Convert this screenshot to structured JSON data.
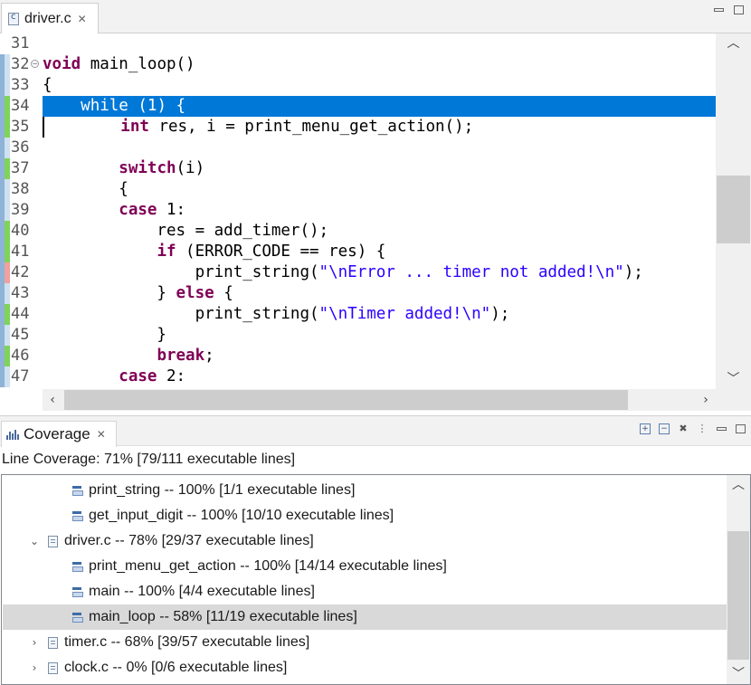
{
  "editor": {
    "tab": {
      "label": "driver.c",
      "icon": "c-file-icon"
    },
    "lines": [
      {
        "num": "31",
        "cov": "",
        "fold": false,
        "hl": false,
        "tokens": []
      },
      {
        "num": "32",
        "cov": "",
        "fold": true,
        "hl": false,
        "tokens": [
          {
            "t": "void",
            "c": "kw"
          },
          {
            "t": " main_loop()",
            "c": ""
          }
        ]
      },
      {
        "num": "33",
        "cov": "",
        "fold": false,
        "hl": false,
        "tokens": [
          {
            "t": "{",
            "c": ""
          }
        ]
      },
      {
        "num": "34",
        "cov": "green",
        "fold": false,
        "hl": true,
        "tokens": [
          {
            "t": "    ",
            "c": ""
          },
          {
            "t": "while",
            "c": "kw"
          },
          {
            "t": " (1) {",
            "c": ""
          }
        ]
      },
      {
        "num": "35",
        "cov": "green",
        "fold": false,
        "hl": false,
        "caret": true,
        "tokens": [
          {
            "t": "        ",
            "c": ""
          },
          {
            "t": "int",
            "c": "kw"
          },
          {
            "t": " res, i = print_menu_get_action();",
            "c": ""
          }
        ]
      },
      {
        "num": "36",
        "cov": "",
        "fold": false,
        "hl": false,
        "tokens": []
      },
      {
        "num": "37",
        "cov": "green",
        "fold": false,
        "hl": false,
        "tokens": [
          {
            "t": "        ",
            "c": ""
          },
          {
            "t": "switch",
            "c": "kw"
          },
          {
            "t": "(i)",
            "c": ""
          }
        ]
      },
      {
        "num": "38",
        "cov": "",
        "fold": false,
        "hl": false,
        "tokens": [
          {
            "t": "        {",
            "c": ""
          }
        ]
      },
      {
        "num": "39",
        "cov": "",
        "fold": false,
        "hl": false,
        "tokens": [
          {
            "t": "        ",
            "c": ""
          },
          {
            "t": "case",
            "c": "kw"
          },
          {
            "t": " 1:",
            "c": ""
          }
        ]
      },
      {
        "num": "40",
        "cov": "green",
        "fold": false,
        "hl": false,
        "tokens": [
          {
            "t": "            res = add_timer();",
            "c": ""
          }
        ]
      },
      {
        "num": "41",
        "cov": "green",
        "fold": false,
        "hl": false,
        "tokens": [
          {
            "t": "            ",
            "c": ""
          },
          {
            "t": "if",
            "c": "kw"
          },
          {
            "t": " (ERROR_CODE == res) {",
            "c": ""
          }
        ]
      },
      {
        "num": "42",
        "cov": "red",
        "fold": false,
        "hl": false,
        "tokens": [
          {
            "t": "                print_string(",
            "c": ""
          },
          {
            "t": "\"\\nError ... timer not added!\\n\"",
            "c": "str"
          },
          {
            "t": ");",
            "c": ""
          }
        ]
      },
      {
        "num": "43",
        "cov": "",
        "fold": false,
        "hl": false,
        "tokens": [
          {
            "t": "            } ",
            "c": ""
          },
          {
            "t": "else",
            "c": "kw"
          },
          {
            "t": " {",
            "c": ""
          }
        ]
      },
      {
        "num": "44",
        "cov": "green",
        "fold": false,
        "hl": false,
        "tokens": [
          {
            "t": "                print_string(",
            "c": ""
          },
          {
            "t": "\"\\nTimer added!\\n\"",
            "c": "str"
          },
          {
            "t": ");",
            "c": ""
          }
        ]
      },
      {
        "num": "45",
        "cov": "",
        "fold": false,
        "hl": false,
        "tokens": [
          {
            "t": "            }",
            "c": ""
          }
        ]
      },
      {
        "num": "46",
        "cov": "green",
        "fold": false,
        "hl": false,
        "tokens": [
          {
            "t": "            ",
            "c": ""
          },
          {
            "t": "break",
            "c": "kw"
          },
          {
            "t": ";",
            "c": ""
          }
        ]
      },
      {
        "num": "47",
        "cov": "",
        "fold": false,
        "hl": false,
        "tokens": [
          {
            "t": "        ",
            "c": ""
          },
          {
            "t": "case",
            "c": "kw"
          },
          {
            "t": " 2:",
            "c": ""
          }
        ]
      }
    ]
  },
  "coverage": {
    "tab_label": "Coverage",
    "summary": "Line Coverage: 71% [79/111 executable lines]",
    "tree": [
      {
        "indent": 2,
        "twisty": "",
        "icon": "function-icon",
        "label": "print_string -- 100% [1/1 executable lines]",
        "selected": false
      },
      {
        "indent": 2,
        "twisty": "",
        "icon": "function-icon",
        "label": "get_input_digit -- 100% [10/10 executable lines]",
        "selected": false
      },
      {
        "indent": 1,
        "twisty": "expanded",
        "icon": "file-icon",
        "label": "driver.c -- 78% [29/37 executable lines]",
        "selected": false
      },
      {
        "indent": 2,
        "twisty": "",
        "icon": "function-icon",
        "label": "print_menu_get_action -- 100% [14/14 executable lines]",
        "selected": false
      },
      {
        "indent": 2,
        "twisty": "",
        "icon": "function-icon",
        "label": "main -- 100% [4/4 executable lines]",
        "selected": false
      },
      {
        "indent": 2,
        "twisty": "",
        "icon": "function-icon",
        "label": "main_loop -- 58% [11/19 executable lines]",
        "selected": true
      },
      {
        "indent": 1,
        "twisty": "collapsed",
        "icon": "file-icon",
        "label": "timer.c -- 68% [39/57 executable lines]",
        "selected": false
      },
      {
        "indent": 1,
        "twisty": "collapsed",
        "icon": "file-icon",
        "label": "clock.c -- 0% [0/6 executable lines]",
        "selected": false
      }
    ]
  },
  "colors": {
    "accent": "#0078d7",
    "keyword": "#7f0055",
    "string": "#2a00ff",
    "covered": "#7fd35c",
    "uncovered": "#f0a0a0",
    "selection": "#d9d9d9"
  }
}
